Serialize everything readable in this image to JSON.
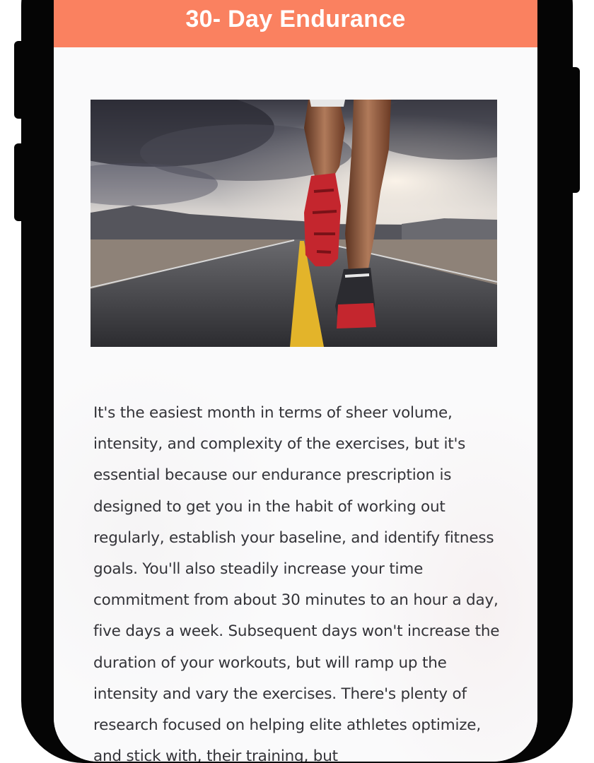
{
  "header": {
    "title": "30- Day Endurance",
    "background_color": "#fa8160"
  },
  "hero_image": {
    "subject": "runner in red sneakers on desert highway under stormy sky"
  },
  "article": {
    "body": "It's the easiest month in terms of sheer volume, intensity, and complexity of the exercises, but it's essential because our endurance prescription is designed to get you in the habit of working out regularly, establish your baseline, and identify fitness goals. You'll also steadily increase your time commitment from about 30 minutes to an hour a day, five days a week. Subsequent days won't increase the duration of your workouts, but will ramp up the intensity and vary the exercises. There's plenty of research focused on helping elite athletes optimize, and stick with, their training, but"
  }
}
